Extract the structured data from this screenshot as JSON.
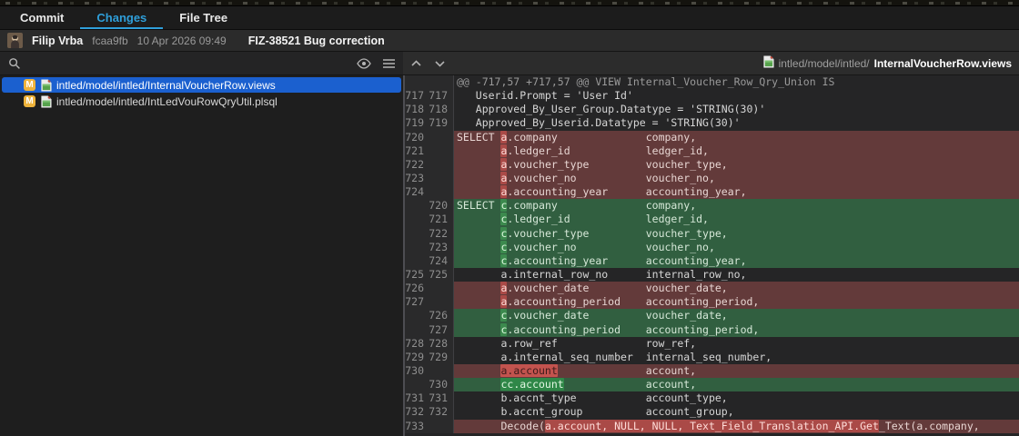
{
  "tabs": [
    {
      "label": "Commit",
      "active": false
    },
    {
      "label": "Changes",
      "active": true
    },
    {
      "label": "File Tree",
      "active": false
    }
  ],
  "commit": {
    "author": "Filip Vrba",
    "hash": "fcaa9fb",
    "date": "10 Apr 2026 09:49",
    "message": "FIZ-38521 Bug correction"
  },
  "icons": {
    "search": "magnifier",
    "visibility": "eye",
    "view_mode": "list-lines",
    "prev_change": "chevron-up",
    "next_change": "chevron-down",
    "file": "modified-document",
    "status_badge": "M"
  },
  "file_panel": {
    "files": [
      {
        "badge": "M",
        "path": "intled/model/intled/InternalVoucherRow.views",
        "selected": true
      },
      {
        "badge": "M",
        "path": "intled/model/intled/IntLedVouRowQryUtil.plsql",
        "selected": false
      }
    ]
  },
  "diff_panel": {
    "header": {
      "dir": "intled/model/intled/",
      "file": "InternalVoucherRow.views"
    },
    "lines": [
      {
        "type": "hunk",
        "old": "",
        "new": "",
        "segments": [
          {
            "t": "@@ -717,57 +717,57 @@ VIEW Internal_Voucher_Row_Qry_Union IS"
          }
        ]
      },
      {
        "type": "context",
        "old": "717",
        "new": "717",
        "segments": [
          {
            "t": "   Userid.Prompt = 'User Id'"
          }
        ]
      },
      {
        "type": "context",
        "old": "718",
        "new": "718",
        "segments": [
          {
            "t": "   Approved_By_User_Group.Datatype = 'STRING(30)'"
          }
        ]
      },
      {
        "type": "context",
        "old": "719",
        "new": "719",
        "segments": [
          {
            "t": "   Approved_By_Userid.Datatype = 'STRING(30)'"
          }
        ]
      },
      {
        "type": "removed",
        "old": "720",
        "new": "",
        "segments": [
          {
            "t": "SELECT "
          },
          {
            "t": "a",
            "hl": 1
          },
          {
            "t": ".company              company,"
          }
        ]
      },
      {
        "type": "removed",
        "old": "721",
        "new": "",
        "segments": [
          {
            "t": "       "
          },
          {
            "t": "a",
            "hl": 1
          },
          {
            "t": ".ledger_id            ledger_id,"
          }
        ]
      },
      {
        "type": "removed",
        "old": "722",
        "new": "",
        "segments": [
          {
            "t": "       "
          },
          {
            "t": "a",
            "hl": 1
          },
          {
            "t": ".voucher_type         voucher_type,"
          }
        ]
      },
      {
        "type": "removed",
        "old": "723",
        "new": "",
        "segments": [
          {
            "t": "       "
          },
          {
            "t": "a",
            "hl": 1
          },
          {
            "t": ".voucher_no           voucher_no,"
          }
        ]
      },
      {
        "type": "removed",
        "old": "724",
        "new": "",
        "segments": [
          {
            "t": "       "
          },
          {
            "t": "a",
            "hl": 1
          },
          {
            "t": ".accounting_year      accounting_year,"
          }
        ]
      },
      {
        "type": "added",
        "old": "",
        "new": "720",
        "segments": [
          {
            "t": "SELECT "
          },
          {
            "t": "c",
            "hl": 1
          },
          {
            "t": ".company              company,"
          }
        ]
      },
      {
        "type": "added",
        "old": "",
        "new": "721",
        "segments": [
          {
            "t": "       "
          },
          {
            "t": "c",
            "hl": 1
          },
          {
            "t": ".ledger_id            ledger_id,"
          }
        ]
      },
      {
        "type": "added",
        "old": "",
        "new": "722",
        "segments": [
          {
            "t": "       "
          },
          {
            "t": "c",
            "hl": 1
          },
          {
            "t": ".voucher_type         voucher_type,"
          }
        ]
      },
      {
        "type": "added",
        "old": "",
        "new": "723",
        "segments": [
          {
            "t": "       "
          },
          {
            "t": "c",
            "hl": 1
          },
          {
            "t": ".voucher_no           voucher_no,"
          }
        ]
      },
      {
        "type": "added",
        "old": "",
        "new": "724",
        "segments": [
          {
            "t": "       "
          },
          {
            "t": "c",
            "hl": 1
          },
          {
            "t": ".accounting_year      accounting_year,"
          }
        ]
      },
      {
        "type": "context",
        "old": "725",
        "new": "725",
        "segments": [
          {
            "t": "       a.internal_row_no      internal_row_no,"
          }
        ]
      },
      {
        "type": "removed",
        "old": "726",
        "new": "",
        "segments": [
          {
            "t": "       "
          },
          {
            "t": "a",
            "hl": 1
          },
          {
            "t": ".voucher_date         voucher_date,"
          }
        ]
      },
      {
        "type": "removed",
        "old": "727",
        "new": "",
        "segments": [
          {
            "t": "       "
          },
          {
            "t": "a",
            "hl": 1
          },
          {
            "t": ".accounting_period    accounting_period,"
          }
        ]
      },
      {
        "type": "added",
        "old": "",
        "new": "726",
        "segments": [
          {
            "t": "       "
          },
          {
            "t": "c",
            "hl": 1
          },
          {
            "t": ".voucher_date         voucher_date,"
          }
        ]
      },
      {
        "type": "added",
        "old": "",
        "new": "727",
        "segments": [
          {
            "t": "       "
          },
          {
            "t": "c",
            "hl": 1
          },
          {
            "t": ".accounting_period    accounting_period,"
          }
        ]
      },
      {
        "type": "context",
        "old": "728",
        "new": "728",
        "segments": [
          {
            "t": "       a.row_ref              row_ref,"
          }
        ]
      },
      {
        "type": "context",
        "old": "729",
        "new": "729",
        "segments": [
          {
            "t": "       a.internal_seq_number  internal_seq_number,"
          }
        ]
      },
      {
        "type": "removed",
        "old": "730",
        "new": "",
        "segments": [
          {
            "t": "       "
          },
          {
            "t": "a.account",
            "hl": 2
          },
          {
            "t": "              account,"
          }
        ]
      },
      {
        "type": "added",
        "old": "",
        "new": "730",
        "segments": [
          {
            "t": "       "
          },
          {
            "t": "cc.account",
            "hl": 2
          },
          {
            "t": "             account,"
          }
        ]
      },
      {
        "type": "context",
        "old": "731",
        "new": "731",
        "segments": [
          {
            "t": "       b.accnt_type           account_type,"
          }
        ]
      },
      {
        "type": "context",
        "old": "732",
        "new": "732",
        "segments": [
          {
            "t": "       b.accnt_group          account_group,"
          }
        ]
      },
      {
        "type": "removed",
        "old": "733",
        "new": "",
        "segments": [
          {
            "t": "       Decode("
          },
          {
            "t": "a.account, NULL, NULL, Text_Field_Translation_API.Get",
            "hl": 1
          },
          {
            "t": "_Text(a.company,"
          }
        ]
      }
    ]
  },
  "colors": {
    "accent_blue": "#2f9fda",
    "selection_blue": "#1b60cf",
    "modified_badge": "#eeb33c",
    "removed_line_bg": "#633a3a",
    "removed_token_bg": "#aa4a47",
    "removed_token_strong_bg": "#c3534e",
    "added_line_bg": "#315f40",
    "added_token_bg": "#3c8a4e",
    "added_token_strong_bg": "#2f8748"
  }
}
